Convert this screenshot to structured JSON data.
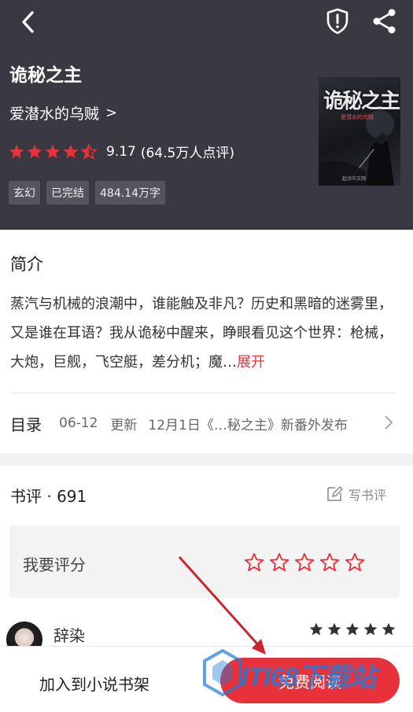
{
  "header": {
    "title": "诡秘之主",
    "author": "爱潜水的乌贼",
    "author_chevron": ">",
    "rating": "9.17",
    "rating_count": "(64.5万人点评)",
    "stars_filled": 4.5,
    "tags": [
      "玄幻",
      "已完结",
      "484.14万字"
    ],
    "cover": {
      "title": "诡秘之主",
      "subtitle": "爱潜水的乌贼",
      "publisher": "起点中文网"
    }
  },
  "intro": {
    "title": "简介",
    "text": "蒸汽与机械的浪潮中，谁能触及非凡？历史和黑暗的迷雾里，又是谁在耳语？我从诡秘中醒来，睁眼看见这个世界：枪械，大炮，巨舰，飞空艇，差分机；魔…",
    "expand": "展开"
  },
  "toc": {
    "label": "目录",
    "date": "06-12",
    "update": "更新",
    "latest": "12月1日《…秘之主》新番外发布"
  },
  "reviews": {
    "title": "书评 · 691",
    "write_label": "写书评",
    "rate_label": "我要评分",
    "rate_stars": 5,
    "items": [
      {
        "name": "辞染",
        "stars": 5
      }
    ]
  },
  "bottom": {
    "add_shelf": "加入到小说书架",
    "read": "免费阅读"
  },
  "watermark": {
    "text": "ITI68下载站"
  },
  "colors": {
    "header_bg": "#3a3942",
    "accent": "#e8323b",
    "star_red": "#e8323b"
  }
}
